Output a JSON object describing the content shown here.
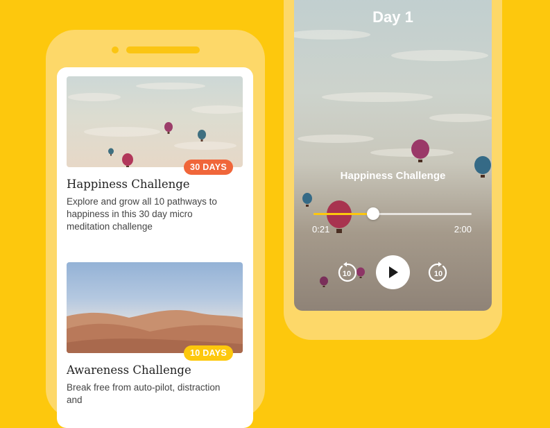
{
  "colors": {
    "background": "#fdc80d",
    "phone_frame": "#fdd869",
    "badge_orange": "#f0663a",
    "badge_yellow": "#fdc80d",
    "progress_accent": "#fdc80d"
  },
  "left_phone": {
    "cards": [
      {
        "image_name": "hot-air-balloons-sky-image",
        "badge": "30 DAYS",
        "title": "Happiness Challenge",
        "description": "Explore and grow all 10 pathways to happiness in this 30 day micro meditation challenge"
      },
      {
        "image_name": "desert-dunes-image",
        "badge": "10 DAYS",
        "title": "Awareness Challenge",
        "description": "Break free from auto-pilot, distraction and"
      }
    ]
  },
  "player": {
    "day_title": "Day 1",
    "track_title": "Happiness Challenge",
    "elapsed": "0:21",
    "duration": "2:00",
    "progress_fraction": 0.375,
    "skip_back_label": "10",
    "skip_forward_label": "10",
    "icons": {
      "play": "play-icon",
      "skip_back": "rewind-10-icon",
      "skip_forward": "forward-10-icon"
    }
  }
}
